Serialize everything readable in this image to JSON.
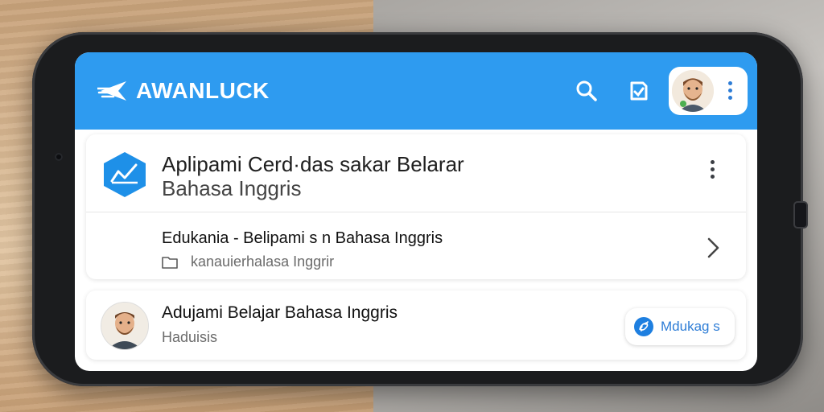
{
  "header": {
    "brand_name": "AWANLUCK",
    "icons": [
      "search-icon",
      "checkbox-icon",
      "avatar",
      "more-vert-icon"
    ],
    "accent_color": "#2e9bf0"
  },
  "app_card": {
    "title_line1": "Aplipami Cerd·das sakar Belarar",
    "title_line2": "Bahasa Inggris",
    "subtitle": "Edukania - Belipami s n Bahasa Inggris",
    "folder_text": "kanauierhalasa Inggrir"
  },
  "lesson_card": {
    "title": "Adujami Belajar Bahasa Inggris",
    "subtitle": "Haduisis",
    "action_label": "Mdukag s"
  }
}
